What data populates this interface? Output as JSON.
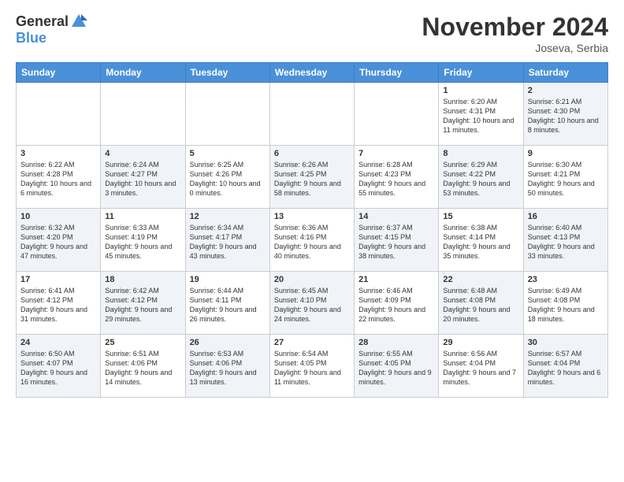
{
  "header": {
    "logo_general": "General",
    "logo_blue": "Blue",
    "month_title": "November 2024",
    "location": "Joseva, Serbia"
  },
  "days_of_week": [
    "Sunday",
    "Monday",
    "Tuesday",
    "Wednesday",
    "Thursday",
    "Friday",
    "Saturday"
  ],
  "weeks": [
    [
      {
        "day": "",
        "info": "",
        "shaded": false,
        "empty": true
      },
      {
        "day": "",
        "info": "",
        "shaded": false,
        "empty": true
      },
      {
        "day": "",
        "info": "",
        "shaded": false,
        "empty": true
      },
      {
        "day": "",
        "info": "",
        "shaded": false,
        "empty": true
      },
      {
        "day": "",
        "info": "",
        "shaded": false,
        "empty": true
      },
      {
        "day": "1",
        "info": "Sunrise: 6:20 AM\nSunset: 4:31 PM\nDaylight: 10 hours and 11 minutes.",
        "shaded": false
      },
      {
        "day": "2",
        "info": "Sunrise: 6:21 AM\nSunset: 4:30 PM\nDaylight: 10 hours and 8 minutes.",
        "shaded": true
      }
    ],
    [
      {
        "day": "3",
        "info": "Sunrise: 6:22 AM\nSunset: 4:28 PM\nDaylight: 10 hours and 6 minutes.",
        "shaded": false
      },
      {
        "day": "4",
        "info": "Sunrise: 6:24 AM\nSunset: 4:27 PM\nDaylight: 10 hours and 3 minutes.",
        "shaded": true
      },
      {
        "day": "5",
        "info": "Sunrise: 6:25 AM\nSunset: 4:26 PM\nDaylight: 10 hours and 0 minutes.",
        "shaded": false
      },
      {
        "day": "6",
        "info": "Sunrise: 6:26 AM\nSunset: 4:25 PM\nDaylight: 9 hours and 58 minutes.",
        "shaded": true
      },
      {
        "day": "7",
        "info": "Sunrise: 6:28 AM\nSunset: 4:23 PM\nDaylight: 9 hours and 55 minutes.",
        "shaded": false
      },
      {
        "day": "8",
        "info": "Sunrise: 6:29 AM\nSunset: 4:22 PM\nDaylight: 9 hours and 53 minutes.",
        "shaded": true
      },
      {
        "day": "9",
        "info": "Sunrise: 6:30 AM\nSunset: 4:21 PM\nDaylight: 9 hours and 50 minutes.",
        "shaded": false
      }
    ],
    [
      {
        "day": "10",
        "info": "Sunrise: 6:32 AM\nSunset: 4:20 PM\nDaylight: 9 hours and 47 minutes.",
        "shaded": true
      },
      {
        "day": "11",
        "info": "Sunrise: 6:33 AM\nSunset: 4:19 PM\nDaylight: 9 hours and 45 minutes.",
        "shaded": false
      },
      {
        "day": "12",
        "info": "Sunrise: 6:34 AM\nSunset: 4:17 PM\nDaylight: 9 hours and 43 minutes.",
        "shaded": true
      },
      {
        "day": "13",
        "info": "Sunrise: 6:36 AM\nSunset: 4:16 PM\nDaylight: 9 hours and 40 minutes.",
        "shaded": false
      },
      {
        "day": "14",
        "info": "Sunrise: 6:37 AM\nSunset: 4:15 PM\nDaylight: 9 hours and 38 minutes.",
        "shaded": true
      },
      {
        "day": "15",
        "info": "Sunrise: 6:38 AM\nSunset: 4:14 PM\nDaylight: 9 hours and 35 minutes.",
        "shaded": false
      },
      {
        "day": "16",
        "info": "Sunrise: 6:40 AM\nSunset: 4:13 PM\nDaylight: 9 hours and 33 minutes.",
        "shaded": true
      }
    ],
    [
      {
        "day": "17",
        "info": "Sunrise: 6:41 AM\nSunset: 4:12 PM\nDaylight: 9 hours and 31 minutes.",
        "shaded": false
      },
      {
        "day": "18",
        "info": "Sunrise: 6:42 AM\nSunset: 4:12 PM\nDaylight: 9 hours and 29 minutes.",
        "shaded": true
      },
      {
        "day": "19",
        "info": "Sunrise: 6:44 AM\nSunset: 4:11 PM\nDaylight: 9 hours and 26 minutes.",
        "shaded": false
      },
      {
        "day": "20",
        "info": "Sunrise: 6:45 AM\nSunset: 4:10 PM\nDaylight: 9 hours and 24 minutes.",
        "shaded": true
      },
      {
        "day": "21",
        "info": "Sunrise: 6:46 AM\nSunset: 4:09 PM\nDaylight: 9 hours and 22 minutes.",
        "shaded": false
      },
      {
        "day": "22",
        "info": "Sunrise: 6:48 AM\nSunset: 4:08 PM\nDaylight: 9 hours and 20 minutes.",
        "shaded": true
      },
      {
        "day": "23",
        "info": "Sunrise: 6:49 AM\nSunset: 4:08 PM\nDaylight: 9 hours and 18 minutes.",
        "shaded": false
      }
    ],
    [
      {
        "day": "24",
        "info": "Sunrise: 6:50 AM\nSunset: 4:07 PM\nDaylight: 9 hours and 16 minutes.",
        "shaded": true
      },
      {
        "day": "25",
        "info": "Sunrise: 6:51 AM\nSunset: 4:06 PM\nDaylight: 9 hours and 14 minutes.",
        "shaded": false
      },
      {
        "day": "26",
        "info": "Sunrise: 6:53 AM\nSunset: 4:06 PM\nDaylight: 9 hours and 13 minutes.",
        "shaded": true
      },
      {
        "day": "27",
        "info": "Sunrise: 6:54 AM\nSunset: 4:05 PM\nDaylight: 9 hours and 11 minutes.",
        "shaded": false
      },
      {
        "day": "28",
        "info": "Sunrise: 6:55 AM\nSunset: 4:05 PM\nDaylight: 9 hours and 9 minutes.",
        "shaded": true
      },
      {
        "day": "29",
        "info": "Sunrise: 6:56 AM\nSunset: 4:04 PM\nDaylight: 9 hours and 7 minutes.",
        "shaded": false
      },
      {
        "day": "30",
        "info": "Sunrise: 6:57 AM\nSunset: 4:04 PM\nDaylight: 9 hours and 6 minutes.",
        "shaded": true
      }
    ]
  ]
}
